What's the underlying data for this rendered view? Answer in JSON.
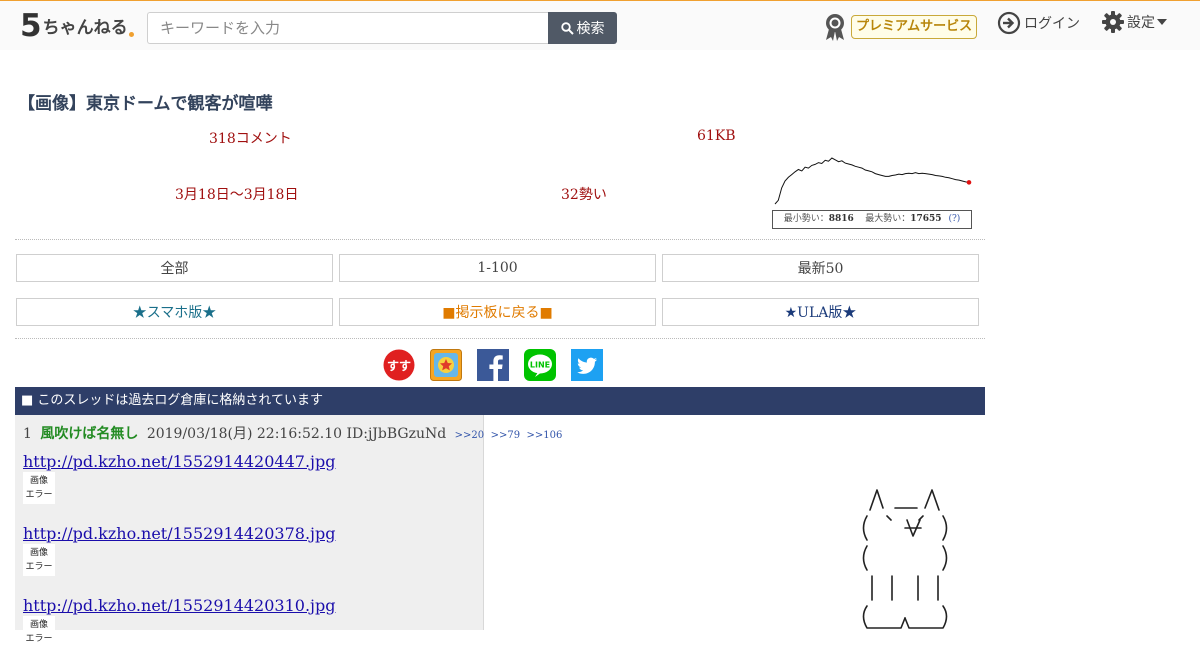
{
  "header": {
    "logo_five": "5",
    "logo_name": "ちゃんねる",
    "search_placeholder": "キーワードを入力",
    "search_button": "検索",
    "premium_label": "プレミアムサービス",
    "login_label": "ログイン",
    "settings_label": "設定"
  },
  "thread": {
    "title": "【画像】東京ドームで観客が喧嘩",
    "comments": "318コメント",
    "size": "61KB",
    "date_range": "3月18日〜3月18日",
    "momentum": "32勢い",
    "chart_min_label": "最小勢い：",
    "chart_min_value": "8816",
    "chart_max_label": "最大勢い：",
    "chart_max_value": "17655",
    "chart_help": "(?)"
  },
  "chart_data": {
    "type": "line",
    "series": [
      {
        "values": [
          0.0,
          0.08,
          0.35,
          0.5,
          0.58,
          0.64,
          0.7,
          0.75,
          0.72,
          0.8,
          0.78,
          0.84,
          0.86,
          0.9,
          0.88,
          0.95,
          0.93,
          1.0,
          0.96,
          0.92,
          0.94,
          0.89,
          0.87,
          0.85,
          0.82,
          0.8,
          0.78,
          0.74,
          0.72,
          0.7,
          0.66,
          0.64,
          0.62,
          0.6,
          0.6,
          0.62,
          0.63,
          0.65,
          0.64,
          0.66,
          0.67,
          0.66,
          0.68,
          0.66,
          0.67,
          0.66,
          0.65,
          0.64,
          0.62,
          0.61,
          0.6,
          0.58,
          0.57,
          0.55,
          0.53,
          0.52,
          0.5,
          0.48,
          0.47
        ]
      }
    ],
    "marker_color": "#e01010",
    "line_color": "#111111"
  },
  "nav": {
    "all": "全部",
    "range": "1-100",
    "latest": "最新50",
    "smartphone": "★スマホ版★",
    "back_to_board": "■掲示板に戻る■",
    "ula": "★ULA版★"
  },
  "social": {
    "icons": [
      "susu-icon",
      "bookmark-icon",
      "facebook-icon",
      "line-icon",
      "twitter-icon"
    ],
    "line_text": "LINE",
    "susu_text": "すす"
  },
  "archive_notice": "■ このスレッドは過去ログ倉庫に格納されています",
  "post": {
    "number": "1",
    "name": "風吹けば名無し",
    "datetime": "2019/03/18(月) 22:16:52.10 ID:jJbBGzuNd",
    "refs": [
      ">>20",
      ">>79",
      ">>106"
    ],
    "links": [
      "http://pd.kzho.net/1552914420447.jpg",
      "http://pd.kzho.net/1552914420378.jpg",
      "http://pd.kzho.net/1552914420310.jpg"
    ],
    "image_error_line1": "画像",
    "image_error_line2": "エラー"
  },
  "colors": {
    "accent_bar": "#2e3e68",
    "meta_text": "#a01010",
    "poster_name": "#228b22",
    "link": "#1a0dab",
    "smartphone_link": "#1a6f8a",
    "board_link": "#e07b00",
    "ula_link": "#1a3a7a"
  }
}
